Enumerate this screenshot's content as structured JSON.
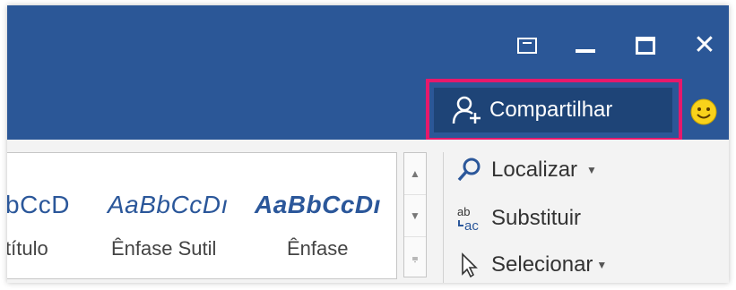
{
  "titlebar": {
    "restore_icon": "ribbon-display-options-icon",
    "minimize_icon": "minimize-icon",
    "maximize_icon": "maximize-icon",
    "close_label": "✕",
    "bg_color": "#2b5797"
  },
  "share": {
    "label": "Compartilhar",
    "icon": "person-add-icon",
    "highlight_color": "#e6196b"
  },
  "feedback_icon": "smiley-icon",
  "styles": [
    {
      "sample": "bCcD",
      "name": "título",
      "bold": false
    },
    {
      "sample": "AaBbCcDı",
      "name": "Ênfase Sutil",
      "bold": false
    },
    {
      "sample": "AaBbCcDı",
      "name": "Ênfase",
      "bold": true
    }
  ],
  "gallery_scroll": {
    "up": "▲",
    "down": "▼",
    "more": "⩦"
  },
  "editing": {
    "find_label": "Localizar",
    "replace_label": "Substituir",
    "select_label": "Selecionar",
    "find_icon": "magnifier-icon",
    "replace_icon": "replace-abc-icon",
    "select_icon": "cursor-arrow-icon"
  }
}
